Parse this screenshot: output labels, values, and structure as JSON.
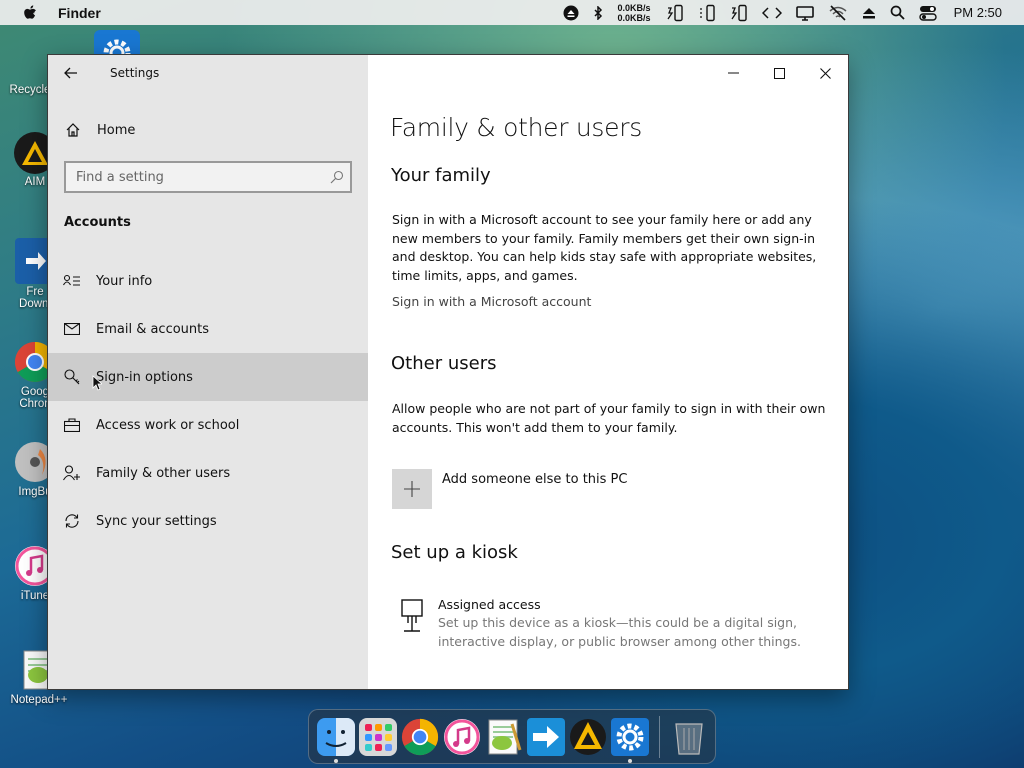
{
  "menubar": {
    "app_name": "Finder",
    "net_up": "0.0KB/s",
    "net_down": "0.0KB/s",
    "clock": "PM 2:50"
  },
  "desktop_icons": [
    {
      "label": "Recycle",
      "icon": "recycle-bin-icon"
    },
    {
      "label": "AIM",
      "icon": "aimp-icon"
    },
    {
      "label": "Fre",
      "label2": "Downl",
      "icon": "free-download-icon"
    },
    {
      "label": "Goog",
      "label2": "Chron",
      "icon": "chrome-icon"
    },
    {
      "label": "ImgBu",
      "icon": "imgburn-icon"
    },
    {
      "label": "iTune",
      "icon": "itunes-icon"
    },
    {
      "label": "Notepad++",
      "icon": "notepadpp-icon"
    }
  ],
  "window": {
    "title": "Settings",
    "sidebar": {
      "home_label": "Home",
      "search_placeholder": "Find a setting",
      "section_label": "Accounts",
      "items": [
        {
          "label": "Your info",
          "icon": "person-card-icon"
        },
        {
          "label": "Email & accounts",
          "icon": "mail-icon"
        },
        {
          "label": "Sign-in options",
          "icon": "key-icon",
          "active": true
        },
        {
          "label": "Access work or school",
          "icon": "briefcase-icon"
        },
        {
          "label": "Family & other users",
          "icon": "add-person-icon"
        },
        {
          "label": "Sync your settings",
          "icon": "sync-icon"
        }
      ]
    },
    "content": {
      "page_title": "Family & other users",
      "family_heading": "Your family",
      "family_text": "Sign in with a Microsoft account to see your family here or add any new members to your family. Family members get their own sign-in and desktop. You can help kids stay safe with appropriate websites, time limits, apps, and games.",
      "family_link": "Sign in with a Microsoft account",
      "other_heading": "Other users",
      "other_text": "Allow people who are not part of your family to sign in with their own accounts. This won't add them to your family.",
      "add_label": "Add someone else to this PC",
      "kiosk_heading": "Set up a kiosk",
      "kiosk_title": "Assigned access",
      "kiosk_desc": "Set up this device as a kiosk—this could be a digital sign, interactive display, or public browser among other things."
    }
  },
  "dock": [
    "finder-icon",
    "launchpad-icon",
    "chrome-icon",
    "itunes-icon",
    "notepadpp-icon",
    "free-download-icon",
    "aimp-icon",
    "settings-icon",
    "trash-icon"
  ],
  "colors": {
    "sidebar_bg": "#e6e6e6",
    "active_item_bg": "#cccccc",
    "add_tile_bg": "#d6d6d6"
  }
}
